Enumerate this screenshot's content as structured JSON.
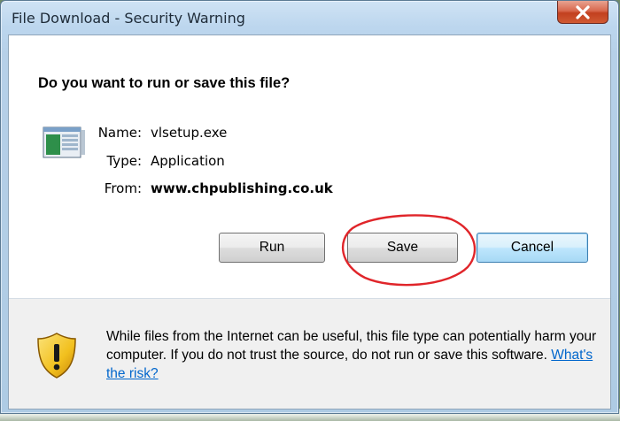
{
  "window": {
    "title": "File Download - Security Warning",
    "close_glyph": "X"
  },
  "dialog": {
    "question": "Do you want to run or save this file?",
    "file_icon": "application-icon",
    "fields": [
      {
        "label": "Name:",
        "value": "vlsetup.exe",
        "bold": false
      },
      {
        "label": "Type:",
        "value": "Application",
        "bold": false
      },
      {
        "label": "From:",
        "value": "www.chpublishing.co.uk",
        "bold": true
      }
    ]
  },
  "buttons": {
    "run": "Run",
    "save": "Save",
    "cancel": "Cancel"
  },
  "warning": {
    "icon": "shield-warning-icon",
    "text": "While files from the Internet can be useful, this file type can potentially harm your computer. If you do not trust the source, do not run or save this software. ",
    "link": "What's the risk?"
  },
  "colors": {
    "annotation_circle": "#e0252a",
    "link": "#0066cc",
    "shield_yellow": "#f2c01e"
  }
}
